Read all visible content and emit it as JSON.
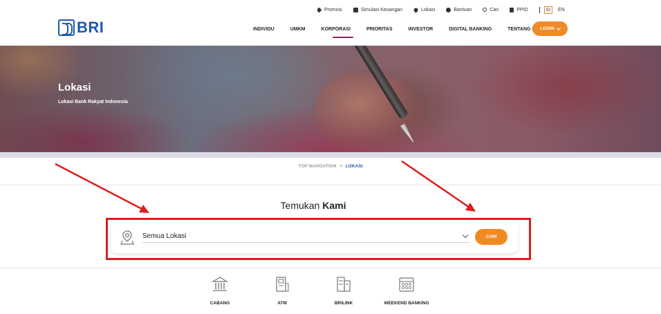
{
  "header": {
    "logo_text": "BRI",
    "utility": [
      {
        "label": "Promosi",
        "icon": "tag-icon"
      },
      {
        "label": "Simulasi Keuangan",
        "icon": "calculator-icon"
      },
      {
        "label": "Lokasi",
        "icon": "map-pin-icon"
      },
      {
        "label": "Bantuan",
        "icon": "help-icon"
      },
      {
        "label": "Cari",
        "icon": "search-icon"
      },
      {
        "label": "PPID",
        "icon": "document-icon"
      }
    ],
    "lang_id": "ID",
    "lang_en": "EN",
    "nav": [
      "INDIVIDU",
      "UMKM",
      "KORPORASI",
      "PRIORITAS",
      "INVESTOR",
      "DIGITAL BANKING",
      "TENTANG BRI"
    ],
    "active_nav": "KORPORASI",
    "login_label": "LOGIN"
  },
  "hero": {
    "title": "Lokasi",
    "subtitle": "Lokasi Bank Rakyat Indonesia"
  },
  "breadcrumb": {
    "root": "TOP NAVIGATION",
    "separator": ">",
    "current": "LOKASI"
  },
  "find": {
    "title_regular": "Temukan",
    "title_bold": "Kami",
    "select_value": "Semua Lokasi",
    "search_button": "CARI"
  },
  "categories": [
    {
      "label": "CABANG",
      "icon": "bank-building-icon"
    },
    {
      "label": "ATM",
      "icon": "atm-icon"
    },
    {
      "label": "BRILINK",
      "icon": "brilink-icon"
    },
    {
      "label": "WEEKEND BANKING",
      "icon": "calendar-icon"
    }
  ],
  "colors": {
    "brand_blue": "#1f5aa6",
    "accent_orange": "#f08a24",
    "nav_active": "#a3195b",
    "annotation_red": "#e01b1b"
  }
}
